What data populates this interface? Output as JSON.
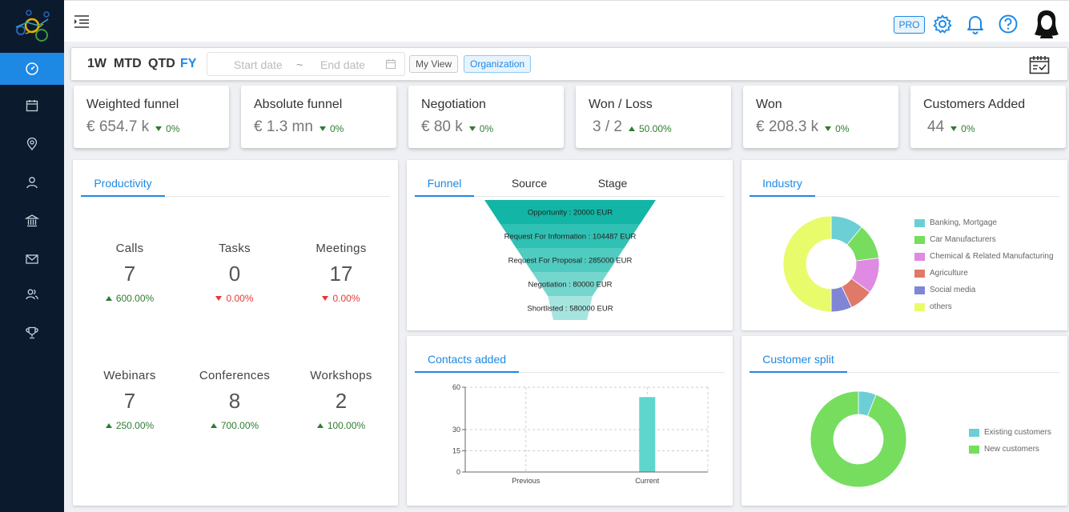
{
  "topbar": {
    "pro_label": "PRO"
  },
  "filters": {
    "periods": [
      "1W",
      "MTD",
      "QTD",
      "FY"
    ],
    "active_period": "FY",
    "start_placeholder": "Start date",
    "separator": "~",
    "end_placeholder": "End date",
    "my_view": "My View",
    "organization": "Organization"
  },
  "kpis": [
    {
      "title": "Weighted funnel",
      "value": "€ 654.7 k",
      "delta": "0%",
      "direction": "down"
    },
    {
      "title": "Absolute funnel",
      "value": "€ 1.3 mn",
      "delta": "0%",
      "direction": "down"
    },
    {
      "title": "Negotiation",
      "value": "€ 80 k",
      "delta": "0%",
      "direction": "down"
    },
    {
      "title": "Won / Loss",
      "value": "3 / 2",
      "delta": "50.00%",
      "direction": "up"
    },
    {
      "title": "Won",
      "value": "€ 208.3 k",
      "delta": "0%",
      "direction": "down"
    },
    {
      "title": "Customers Added",
      "value": "44",
      "delta": "0%",
      "direction": "down"
    }
  ],
  "productivity": {
    "tab": "Productivity",
    "stats": [
      {
        "label": "Calls",
        "value": "7",
        "delta": "600.00%",
        "direction": "up"
      },
      {
        "label": "Tasks",
        "value": "0",
        "delta": "0.00%",
        "direction": "down"
      },
      {
        "label": "Meetings",
        "value": "17",
        "delta": "0.00%",
        "direction": "down"
      },
      {
        "label": "Webinars",
        "value": "7",
        "delta": "250.00%",
        "direction": "up"
      },
      {
        "label": "Conferences",
        "value": "8",
        "delta": "700.00%",
        "direction": "up"
      },
      {
        "label": "Workshops",
        "value": "2",
        "delta": "100.00%",
        "direction": "up"
      }
    ]
  },
  "funnel_panel": {
    "tabs": [
      "Funnel",
      "Source",
      "Stage"
    ],
    "active_tab": "Funnel",
    "stages": [
      {
        "label": "Opportunity : 20000 EUR",
        "color": "#12b5a6"
      },
      {
        "label": "Request For Information : 104487 EUR",
        "color": "#2fc1b3"
      },
      {
        "label": "Request For Proposal : 285000 EUR",
        "color": "#4fcbbf"
      },
      {
        "label": "Negotiation : 80000 EUR",
        "color": "#75d6cd"
      },
      {
        "label": "Shortlisted : 580000 EUR",
        "color": "#a6e5df"
      }
    ]
  },
  "industry": {
    "tab": "Industry",
    "legend": [
      {
        "name": "Banking, Mortgage",
        "color": "#6ccfd6"
      },
      {
        "name": "Car Manufacturers",
        "color": "#76dd5f"
      },
      {
        "name": "Chemical & Related Manufacturing",
        "color": "#df8ae3"
      },
      {
        "name": "Agriculture",
        "color": "#df7a6a"
      },
      {
        "name": "Social media",
        "color": "#7f86d6"
      },
      {
        "name": "others",
        "color": "#e8fb6b"
      }
    ]
  },
  "contacts_added": {
    "tab": "Contacts added"
  },
  "customer_split": {
    "tab": "Customer split",
    "legend": [
      {
        "name": "Existing customers",
        "color": "#6ccfd6"
      },
      {
        "name": "New customers",
        "color": "#76dd5f"
      }
    ]
  },
  "chart_data": [
    {
      "type": "bar",
      "title": "Contacts added",
      "categories": [
        "Previous",
        "Current"
      ],
      "values": [
        0,
        53
      ],
      "ylim": [
        0,
        60
      ],
      "yticks": [
        0,
        15,
        30,
        60
      ],
      "color": "#5fd6cd",
      "grid": true
    },
    {
      "type": "pie",
      "title": "Industry",
      "labels": [
        "Banking, Mortgage",
        "Car Manufacturers",
        "Chemical & Related Manufacturing",
        "Agriculture",
        "Social media",
        "others"
      ],
      "values": [
        11,
        12,
        12,
        8,
        7,
        50
      ],
      "donut": true
    },
    {
      "type": "pie",
      "title": "Customer split",
      "labels": [
        "Existing customers",
        "New customers"
      ],
      "values": [
        6,
        94
      ],
      "donut": true
    }
  ]
}
